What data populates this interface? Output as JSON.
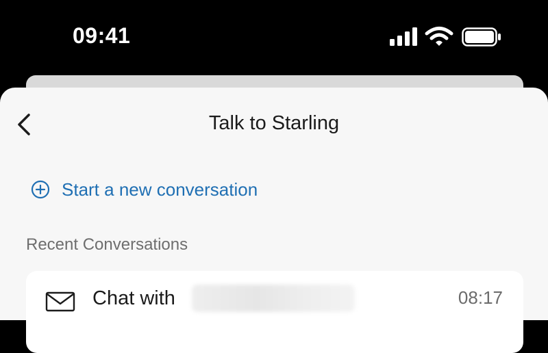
{
  "status_bar": {
    "time": "09:41",
    "icons": [
      "cellular-signal-icon",
      "wifi-icon",
      "battery-icon"
    ]
  },
  "nav": {
    "back_icon": "chevron-left-icon",
    "title": "Talk to Starling"
  },
  "actions": {
    "new_conversation_icon": "plus-circle-icon",
    "new_conversation_label": "Start a new conversation"
  },
  "recent": {
    "heading": "Recent Conversations",
    "items": [
      {
        "icon": "mail-icon",
        "title": "Chat with",
        "time": "08:17"
      }
    ]
  },
  "colors": {
    "accent": "#1f6fb3",
    "sheet_background": "#f7f7f7",
    "status_bar_background": "#000000"
  }
}
